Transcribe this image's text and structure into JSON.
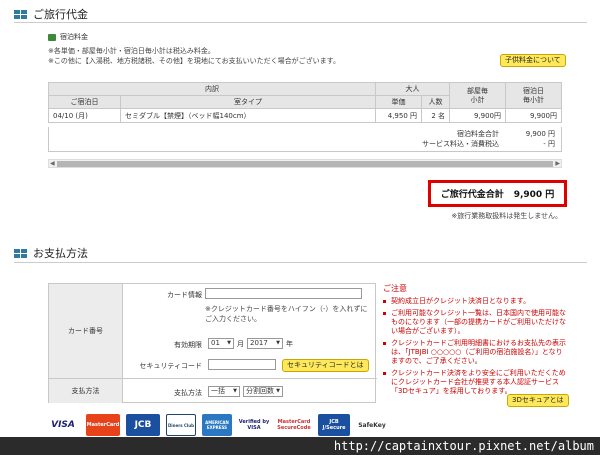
{
  "fare": {
    "title": "ご旅行代金",
    "sub_title": "宿泊料金",
    "note1": "※各単価・部屋毎小計・宿泊日毎小計は税込み料金。",
    "note2": "※この他に【入湯税、地方税諸税、その他】を現地にてお支払いいただく場合がございます。",
    "child_fare_button": "子供料金について",
    "table": {
      "h_breakdown": "内訳",
      "h_adult": "大人",
      "h_room_sub": "部屋毎\n小計",
      "h_day_sub": "宿泊日\n毎小計",
      "h_date": "ご宿泊日",
      "h_room_type": "室タイプ",
      "h_unit_price": "単価",
      "h_people": "人数",
      "row": {
        "date": "04/10 (月)",
        "room_type": "セミダブル【禁煙】（ベッド幅140cm）",
        "unit_price": "4,950 円",
        "people": "2 名",
        "room_subtotal": "9,900円",
        "day_subtotal": "9,900円"
      }
    },
    "summary_label1": "宿泊料金合計",
    "summary_label2": "サービス料込・消費税込",
    "summary_value1": "9,900 円",
    "summary_value2": "- 円",
    "total_label": "ご旅行代金合計",
    "total_value": "9,900 円",
    "total_note": "※旅行業務取扱料は発生しません。"
  },
  "payment": {
    "title": "お支払方法",
    "card_number_label": "カード番号",
    "card_info_label": "カード情報",
    "card_hint": "※クレジットカード番号をハイフン（-）を入れずにご入力ください。",
    "expiry_label": "有効期限",
    "month_value": "01",
    "month_unit": "月",
    "year_value": "2017",
    "year_unit": "年",
    "security_label": "セキュリティコード",
    "security_button": "セキュリティコードとは",
    "method_label": "支払方法",
    "method_field_label": "支払方法",
    "method_value": "一括",
    "installment_value": "分割回数",
    "caution_title": "ご注意",
    "cautions": [
      "契約成立日がクレジット決済日となります。",
      "ご利用可能なクレジット一覧は、日本国内で使用可能なものになります（一部の提携カードがご利用いただけない場合がございます）。",
      "クレジットカードご利用明細書におけるお支払先の表示は、「JTBJBI ○○○○○（ご利用の宿泊施設名）」となりますので、ご了承ください。",
      "クレジットカード決済をより安全にご利用いただくためにクレジットカード会社が推奨する本人認証サービス「3Dセキュア」を採用しております。"
    ],
    "secure_button": "3Dセキュアとは"
  },
  "logos": [
    "VISA",
    "MasterCard",
    "JCB",
    "Diners Club",
    "AMERICAN EXPRESS",
    "Verified by VISA",
    "MasterCard SecureCode",
    "JCB J/Secure",
    "SafeKey"
  ],
  "watermark": "http://captainxtour.pixnet.net/album",
  "colors": {
    "accent_red": "#e10000",
    "button_yellow": "#ffe95a",
    "header_gray": "#e6e6e6"
  }
}
